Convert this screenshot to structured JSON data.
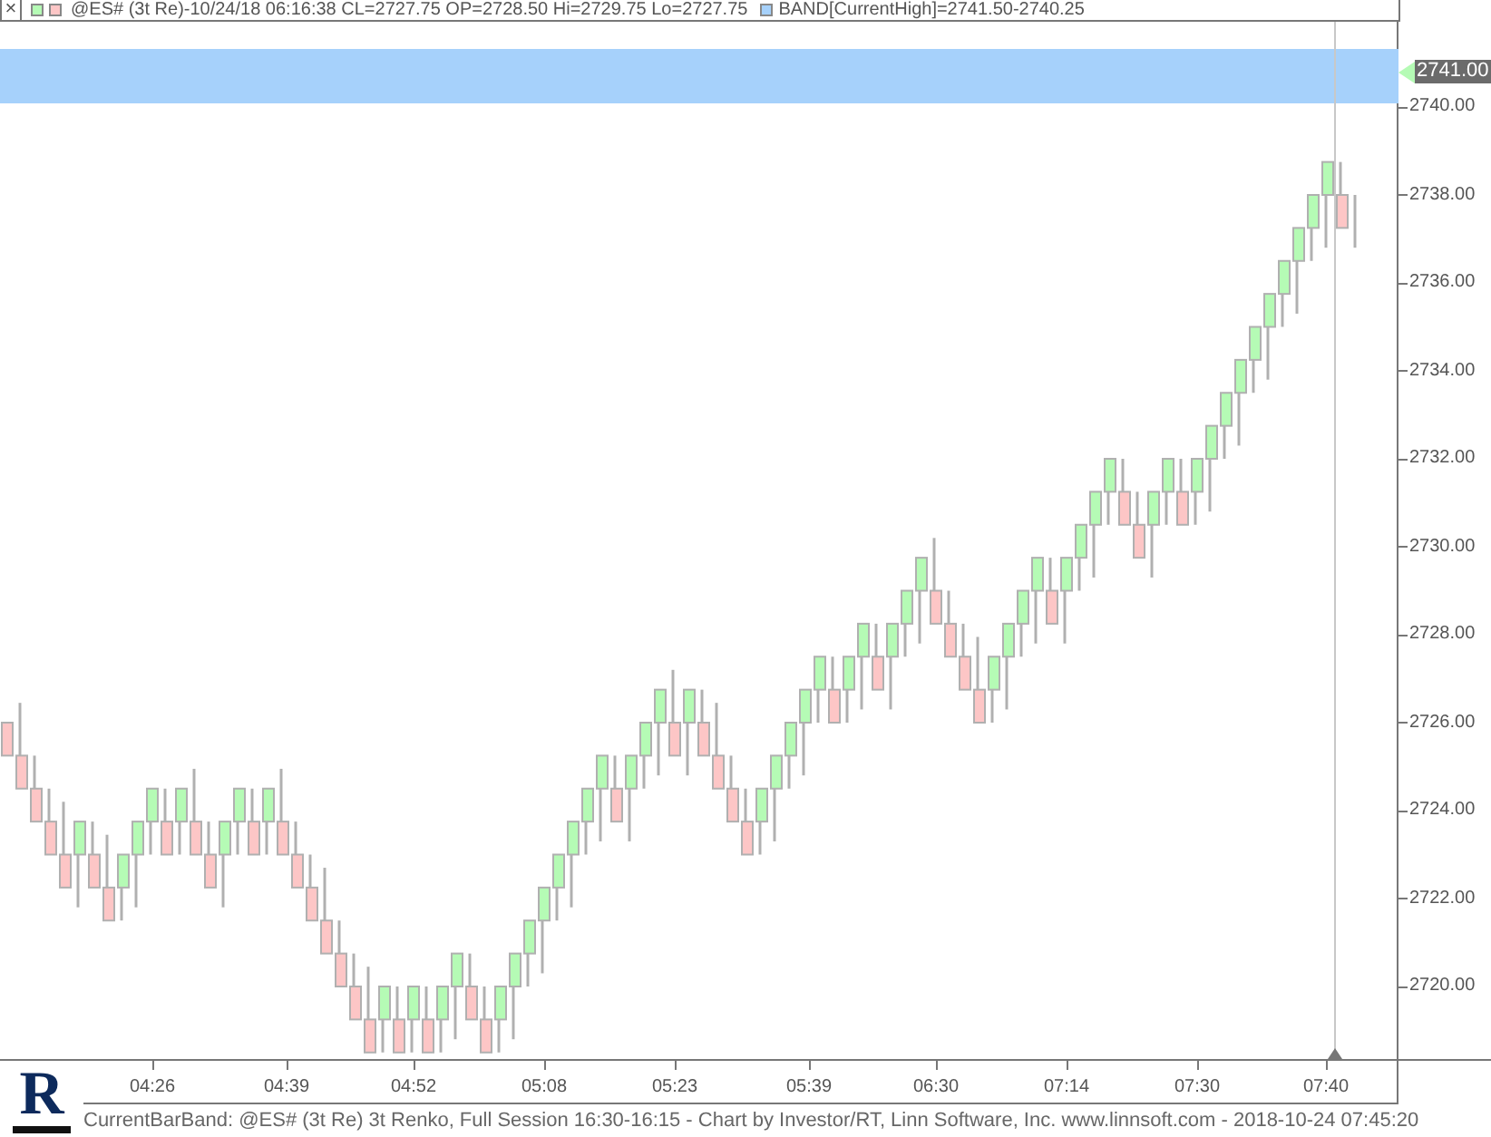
{
  "header": {
    "close": "×",
    "quote": "@ES# (3t Re)-10/24/18 06:16:38 CL=2727.75 OP=2728.50 Hi=2729.75 Lo=2727.75",
    "band_legend": "BAND[CurrentHigh]=2741.50-2740.25"
  },
  "price_axis": {
    "labels": [
      "2740.00",
      "2738.00",
      "2736.00",
      "2734.00",
      "2732.00",
      "2730.00",
      "2728.00",
      "2726.00",
      "2724.00",
      "2722.00",
      "2720.00"
    ],
    "current_price": "2741.00"
  },
  "time_axis": {
    "labels": [
      "04:26",
      "04:39",
      "04:52",
      "05:08",
      "05:23",
      "05:39",
      "06:30",
      "07:14",
      "07:30",
      "07:40"
    ]
  },
  "logo": {
    "letter": "R"
  },
  "footer": "CurrentBarBand: @ES# (3t Re) 3t Renko, Full Session 16:30-16:15 - Chart by Investor/RT, Linn Software, Inc. www.linnsoft.com - 2018-10-24 07:45:20"
}
